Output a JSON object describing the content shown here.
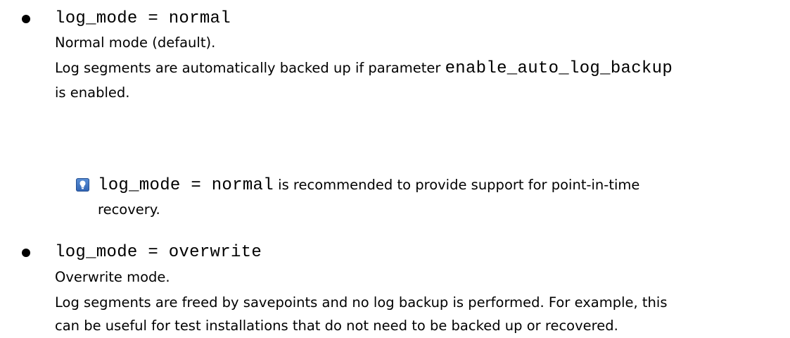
{
  "items": [
    {
      "code": "log_mode = normal",
      "title": "Normal mode (default).",
      "desc_prefix": "Log segments are automatically backed up if parameter ",
      "desc_code": "enable_auto_log_backup",
      "desc_suffix": "is enabled.",
      "tip": {
        "icon": "lightbulb-icon",
        "code": "log_mode = normal",
        "text_1": " is recommended to provide support for point-in-time",
        "text_2": "recovery."
      }
    },
    {
      "code": "log_mode = overwrite",
      "title": "Overwrite mode.",
      "desc_1": "Log segments are freed by savepoints and no log backup is performed. For example, this",
      "desc_2": "can be useful for test installations that do not need to be backed up or recovered."
    }
  ],
  "colors": {
    "text": "#000000",
    "tip_icon": "#3a6fc0"
  }
}
